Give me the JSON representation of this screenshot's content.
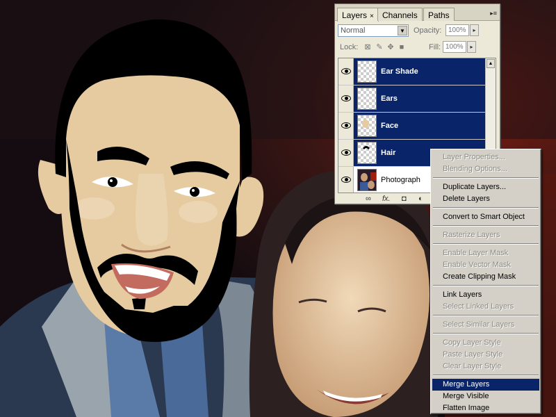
{
  "panel": {
    "tabs": [
      {
        "label": "Layers",
        "close": "×"
      },
      {
        "label": "Channels"
      },
      {
        "label": "Paths"
      }
    ],
    "menu_glyph": "▸≡",
    "blend_mode": "Normal",
    "opacity_label": "Opacity:",
    "opacity_value": "100%",
    "lock_label": "Lock:",
    "fill_label": "Fill:",
    "fill_value": "100%",
    "layers": [
      {
        "name": "Ear Shade",
        "selected": true
      },
      {
        "name": "Ears",
        "selected": true
      },
      {
        "name": "Face",
        "selected": true
      },
      {
        "name": "Hair",
        "selected": true
      },
      {
        "name": "Photograph",
        "selected": false
      }
    ],
    "bottom_icons": [
      "link-icon",
      "fx-icon",
      "mask-icon",
      "adjustment-icon"
    ],
    "bottom_fx": "fx."
  },
  "context_menu": {
    "items": [
      {
        "label": "Layer Properties...",
        "enabled": false
      },
      {
        "label": "Blending Options...",
        "enabled": false
      },
      {
        "label": "Duplicate Layers...",
        "enabled": true
      },
      {
        "label": "Delete Layers",
        "enabled": true
      },
      {
        "label": "Convert to Smart Object",
        "enabled": true
      },
      {
        "label": "Rasterize Layers",
        "enabled": false
      },
      {
        "label": "Enable Layer Mask",
        "enabled": false
      },
      {
        "label": "Enable Vector Mask",
        "enabled": false
      },
      {
        "label": "Create Clipping Mask",
        "enabled": true
      },
      {
        "label": "Link Layers",
        "enabled": true
      },
      {
        "label": "Select Linked Layers",
        "enabled": false
      },
      {
        "label": "Select Similar Layers",
        "enabled": false
      },
      {
        "label": "Copy Layer Style",
        "enabled": false
      },
      {
        "label": "Paste Layer Style",
        "enabled": false
      },
      {
        "label": "Clear Layer Style",
        "enabled": false
      },
      {
        "label": "Merge Layers",
        "enabled": true,
        "highlighted": true
      },
      {
        "label": "Merge Visible",
        "enabled": true
      },
      {
        "label": "Flatten Image",
        "enabled": true
      }
    ]
  },
  "colors": {
    "selection": "#0a246a",
    "menu_bg": "#d4d0c8",
    "panel_bg": "#ece9d8",
    "skin": "#e5cb9f",
    "hair": "#000000"
  }
}
